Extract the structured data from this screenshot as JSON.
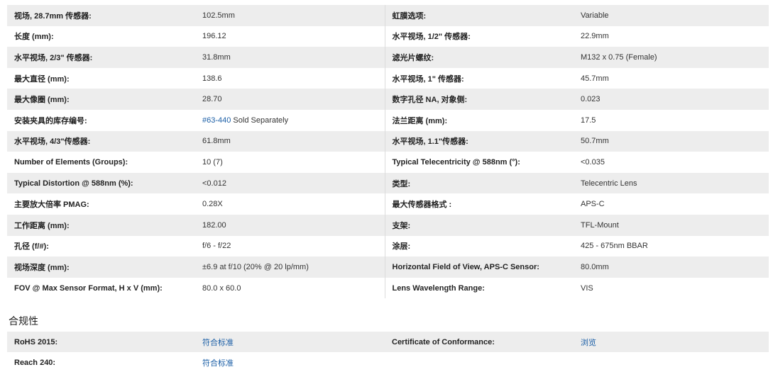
{
  "specs": [
    {
      "l1": "视场, 28.7mm 传感器:",
      "v1": "102.5mm",
      "l2": "虹膜选项:",
      "v2": "Variable"
    },
    {
      "l1": "长度 (mm):",
      "v1": "196.12",
      "l2": "水平视场, 1/2\" 传感器:",
      "v2": "22.9mm"
    },
    {
      "l1": "水平视场, 2/3\" 传感器:",
      "v1": "31.8mm",
      "l2": "滤光片螺纹:",
      "v2": "M132 x 0.75 (Female)"
    },
    {
      "l1": "最大直径 (mm):",
      "v1": "138.6",
      "l2": "水平视场, 1\" 传感器:",
      "v2": "45.7mm"
    },
    {
      "l1": "最大像圈 (mm):",
      "v1": "28.70",
      "l2": "数字孔径 NA, 对象侧:",
      "v2": "0.023"
    },
    {
      "l1": "安装夹具的库存编号:",
      "v1_link": "#63-440",
      "v1_rest": " Sold Separately",
      "l2": "法兰距离 (mm):",
      "v2": "17.5"
    },
    {
      "l1": "水平视场, 4/3\"传感器:",
      "v1": "61.8mm",
      "l2": "水平视场, 1.1\"传感器:",
      "v2": "50.7mm"
    },
    {
      "l1": "Number of Elements (Groups):",
      "v1": "10 (7)",
      "l2": "Typical Telecentricity @ 588nm (°):",
      "v2": "<0.035"
    },
    {
      "l1": "Typical Distortion @ 588nm (%):",
      "v1": "<0.012",
      "l2": "类型:",
      "v2": "Telecentric Lens"
    },
    {
      "l1": "主要放大倍率 PMAG:",
      "v1": "0.28X",
      "l2": "最大传感器格式 :",
      "v2": "APS-C"
    },
    {
      "l1": "工作距离 (mm):",
      "v1": "182.00",
      "l2": "支架:",
      "v2": "TFL-Mount"
    },
    {
      "l1": "孔径 (f/#):",
      "v1": "f/6 - f/22",
      "l2": "涂层:",
      "v2": "425 - 675nm BBAR"
    },
    {
      "l1": "视场深度 (mm):",
      "v1": "±6.9 at f/10 (20% @ 20 lp/mm)",
      "l2": "Horizontal Field of View, APS-C Sensor:",
      "v2": "80.0mm"
    },
    {
      "l1": "FOV @ Max Sensor Format, H x V (mm):",
      "v1": "80.0 x 60.0",
      "l2": "Lens Wavelength Range:",
      "v2": "VIS"
    }
  ],
  "compliance": {
    "title": "合规性",
    "rows": [
      {
        "l1": "RoHS 2015:",
        "v1": "符合标准",
        "l2": "Certificate of Conformance:",
        "v2": "浏览"
      },
      {
        "l1": "Reach 240:",
        "v1": "符合标准",
        "l2": "",
        "v2": ""
      }
    ]
  }
}
